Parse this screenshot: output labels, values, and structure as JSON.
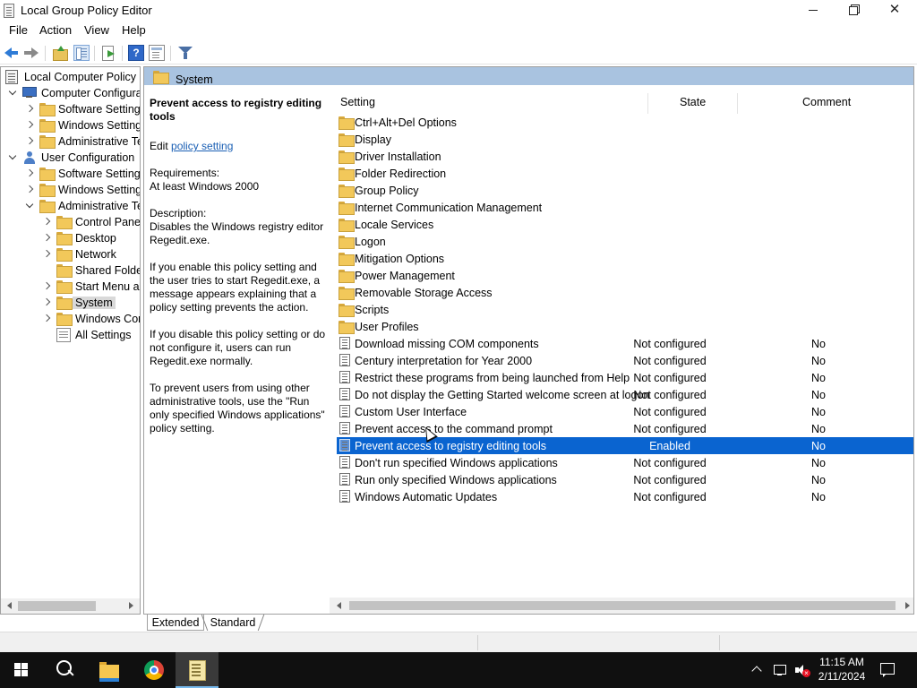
{
  "window": {
    "title": "Local Group Policy Editor",
    "app_icon": "gpedit-icon"
  },
  "menu": [
    "File",
    "Action",
    "View",
    "Help"
  ],
  "toolbar": {
    "icons": [
      "back-arrow-icon",
      "forward-arrow-icon",
      "up-folder-icon",
      "show-hide-tree-icon",
      "export-list-icon",
      "help-icon",
      "properties-icon",
      "filter-icon"
    ],
    "help_glyph": "?"
  },
  "tree": {
    "root": "Local Computer Policy",
    "computer_config": "Computer Configura",
    "cc_software": "Software Settings",
    "cc_windows": "Windows Setting",
    "cc_admin": "Administrative Te",
    "user_config": "User Configuration",
    "uc_software": "Software Settings",
    "uc_windows": "Windows Setting",
    "uc_admin": "Administrative Te",
    "control_panel": "Control Panel",
    "desktop": "Desktop",
    "network": "Network",
    "shared_folders": "Shared Folder",
    "start_menu": "Start Menu ar",
    "system": "System",
    "windows_components": "Windows Cor",
    "all_settings": "All Settings"
  },
  "header": {
    "title": "System"
  },
  "description": {
    "title": "Prevent access to registry editing tools",
    "edit_prefix": "Edit",
    "edit_link": "policy setting",
    "requirements_label": "Requirements:",
    "requirements_value": "At least Windows 2000",
    "description_label": "Description:",
    "description_text": "Disables the Windows registry editor Regedit.exe.",
    "para_enable": "If you enable this policy setting and the user tries to start Regedit.exe, a message appears explaining that a policy setting prevents the action.",
    "para_disable": "If you disable this policy setting or do not configure it, users can run Regedit.exe normally.",
    "para_prevent": "To prevent users from using other administrative tools, use the \"Run only specified Windows applications\" policy setting."
  },
  "list": {
    "columns": [
      "Setting",
      "State",
      "Comment"
    ],
    "folders": [
      "Ctrl+Alt+Del Options",
      "Display",
      "Driver Installation",
      "Folder Redirection",
      "Group Policy",
      "Internet Communication Management",
      "Locale Services",
      "Logon",
      "Mitigation Options",
      "Power Management",
      "Removable Storage Access",
      "Scripts",
      "User Profiles"
    ],
    "settings": [
      {
        "name": "Download missing COM components",
        "state": "Not configured",
        "comment": "No"
      },
      {
        "name": "Century interpretation for Year 2000",
        "state": "Not configured",
        "comment": "No"
      },
      {
        "name": "Restrict these programs from being launched from Help",
        "state": "Not configured",
        "comment": "No"
      },
      {
        "name": "Do not display the Getting Started welcome screen at logon",
        "state": "Not configured",
        "comment": "No"
      },
      {
        "name": "Custom User Interface",
        "state": "Not configured",
        "comment": "No"
      },
      {
        "name": "Prevent access to the command prompt",
        "state": "Not configured",
        "comment": "No"
      },
      {
        "name": "Prevent access to registry editing tools",
        "state": "Enabled",
        "comment": "No",
        "selected": true
      },
      {
        "name": "Don't run specified Windows applications",
        "state": "Not configured",
        "comment": "No"
      },
      {
        "name": "Run only specified Windows applications",
        "state": "Not configured",
        "comment": "No"
      },
      {
        "name": "Windows Automatic Updates",
        "state": "Not configured",
        "comment": "No"
      }
    ]
  },
  "tabs": [
    "Extended",
    "Standard"
  ],
  "taskbar": {
    "apps": [
      "start-icon",
      "search-icon",
      "file-explorer-icon",
      "chrome-icon",
      "gpedit-taskbar-icon"
    ],
    "time": "11:15 AM",
    "date": "2/11/2024"
  },
  "colors": {
    "selection": "#0a64d0",
    "header_band": "#a9c3e0",
    "link": "#1a5fb4",
    "taskbar": "#101010"
  }
}
